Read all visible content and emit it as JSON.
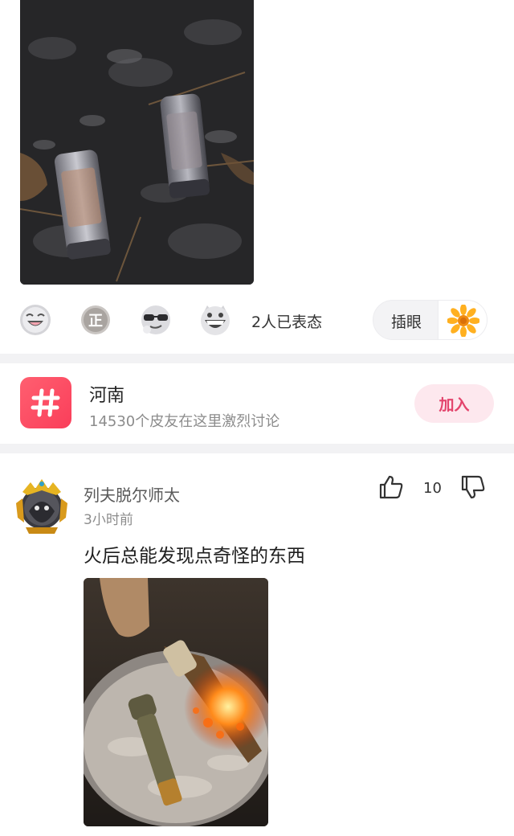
{
  "reactions": {
    "emojis": [
      "laughing-face",
      "zheng-badge",
      "sunglasses-face",
      "grinning-cat-face"
    ],
    "summary": "2人已表态",
    "insert_label": "插眼",
    "insert_icon": "sunflower"
  },
  "topic": {
    "title": "河南",
    "subtitle": "14530个皮友在这里激烈讨论",
    "join_label": "加入",
    "icon": "hashtag",
    "accent": "#fa3e5a"
  },
  "post": {
    "username": "列夫脱尔师太",
    "time": "3小时前",
    "likes": "10",
    "text": "火后总能发现点奇怪的东西"
  }
}
